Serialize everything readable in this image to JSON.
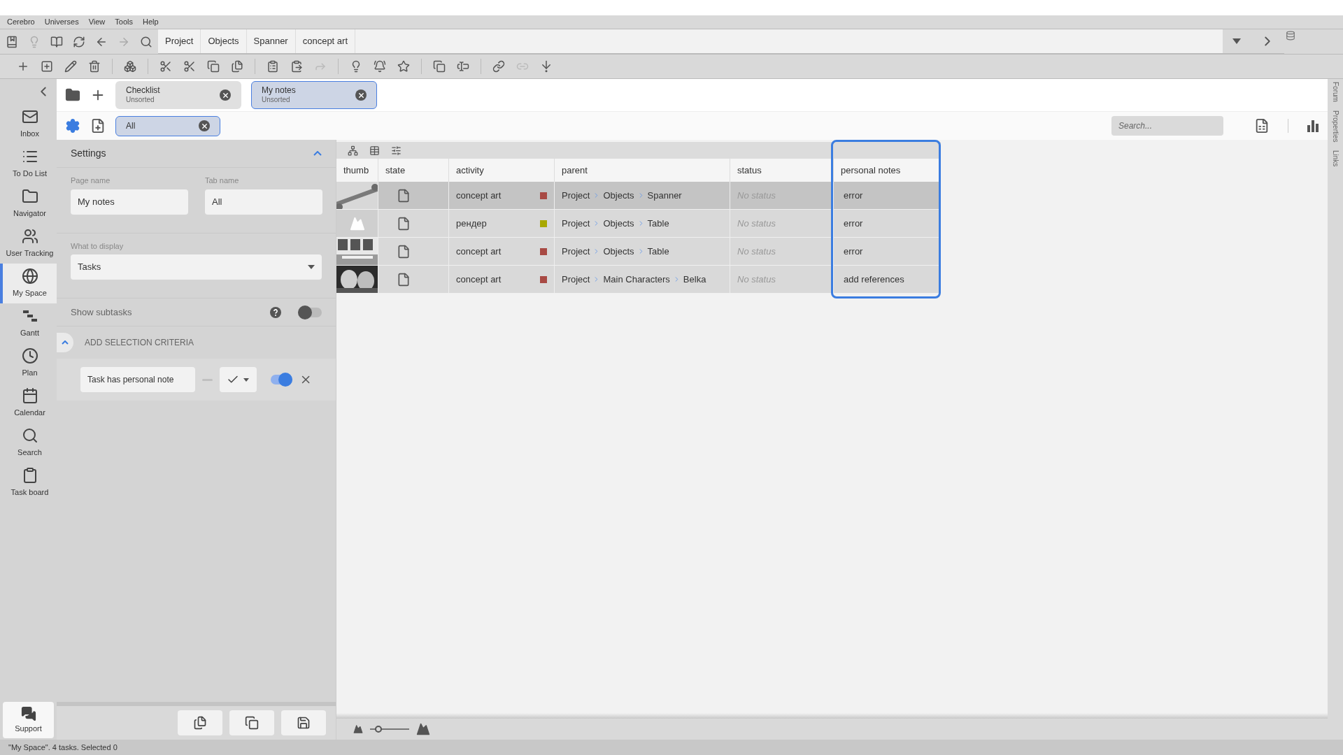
{
  "menu": [
    "Cerebro",
    "Universes",
    "View",
    "Tools",
    "Help"
  ],
  "toolbar_top": [
    {
      "disabled": false
    },
    {
      "disabled": true
    },
    {
      "disabled": false
    },
    {
      "disabled": false
    },
    {
      "disabled": false
    },
    {
      "disabled": true
    },
    {
      "disabled": false
    }
  ],
  "breadcrumbs": [
    "Project",
    "Objects",
    "Spanner",
    "concept art"
  ],
  "toolbar": [
    {
      "disabled": false
    },
    {
      "disabled": false
    },
    {
      "disabled": false
    },
    {
      "disabled": false
    },
    {
      "disabled": false
    },
    {
      "disabled": false
    },
    {
      "disabled": false
    },
    {
      "disabled": false
    },
    {
      "disabled": false
    },
    {
      "disabled": false
    },
    {
      "disabled": false
    },
    {
      "disabled": true
    },
    {
      "disabled": false
    },
    {
      "disabled": false
    },
    {
      "disabled": false
    },
    {
      "disabled": false
    },
    {
      "disabled": false
    },
    {
      "disabled": false
    },
    {
      "disabled": true
    },
    {
      "disabled": false
    }
  ],
  "sidebar": {
    "items": [
      {
        "label": "Inbox",
        "selected": false
      },
      {
        "label": "To Do List",
        "selected": false
      },
      {
        "label": "Navigator",
        "selected": false
      },
      {
        "label": "User Tracking",
        "selected": false
      },
      {
        "label": "My Space",
        "selected": true
      },
      {
        "label": "Gantt",
        "selected": false
      },
      {
        "label": "Plan",
        "selected": false
      },
      {
        "label": "Calendar",
        "selected": false
      },
      {
        "label": "Search",
        "selected": false
      },
      {
        "label": "Task board",
        "selected": false
      }
    ],
    "support": "Support"
  },
  "page_tabs": [
    {
      "title": "Checklist",
      "subtitle": "Unsorted",
      "selected": false
    },
    {
      "title": "My notes",
      "subtitle": "Unsorted",
      "selected": true
    }
  ],
  "sub_tabs": [
    {
      "label": "All",
      "selected": true
    }
  ],
  "search": {
    "placeholder": "Search..."
  },
  "settings": {
    "title": "Settings",
    "expanded": true,
    "page_name_label": "Page name",
    "page_name": "My notes",
    "tab_name_label": "Tab name",
    "tab_name": "All",
    "display_label": "What to display",
    "display_value": "Tasks",
    "subtasks_label": "Show subtasks",
    "show_subtasks": false,
    "criteria_title": "ADD SELECTION CRITERIA",
    "criteria": [
      {
        "label": "Task has personal note",
        "on": true
      }
    ]
  },
  "table": {
    "columns": [
      "thumb",
      "state",
      "activity",
      "parent",
      "status",
      "personal notes"
    ],
    "rows": [
      {
        "selected": true,
        "thumb": {
          "kind": "picture"
        },
        "activity": "concept art",
        "color": "#a84a44",
        "parent": [
          "Project",
          "Objects",
          "Spanner"
        ],
        "status": "No status",
        "personal_notes": "error"
      },
      {
        "selected": false,
        "thumb": {
          "kind": "placeholder"
        },
        "activity": "рендер",
        "color": "#a8a800",
        "parent": [
          "Project",
          "Objects",
          "Table"
        ],
        "status": "No status",
        "personal_notes": "error"
      },
      {
        "selected": false,
        "thumb": {
          "kind": "picture"
        },
        "activity": "concept art",
        "color": "#a84a44",
        "parent": [
          "Project",
          "Objects",
          "Table"
        ],
        "status": "No status",
        "personal_notes": "error"
      },
      {
        "selected": false,
        "thumb": {
          "kind": "picture"
        },
        "activity": "concept art",
        "color": "#a84a44",
        "parent": [
          "Project",
          "Main Characters",
          "Belka"
        ],
        "status": "No status",
        "personal_notes": "add references"
      }
    ]
  },
  "zoom": {
    "level": 0.15
  },
  "right_tabs": [
    "Forum",
    "Properties",
    "Links"
  ],
  "status_bar": "\"My Space\". 4 tasks. Selected 0"
}
